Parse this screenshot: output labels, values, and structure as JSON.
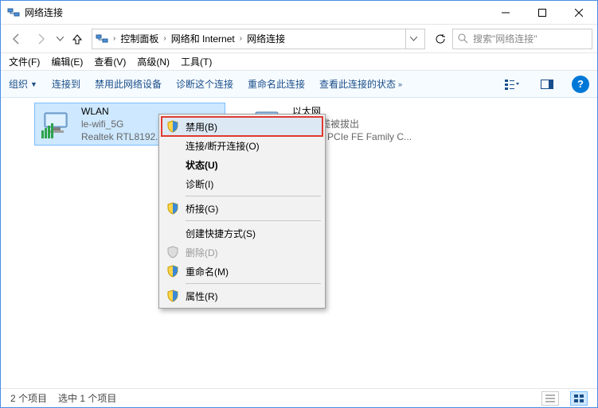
{
  "window": {
    "title": "网络连接",
    "minimize": "—",
    "maximize": "☐",
    "close": "✕"
  },
  "breadcrumb": {
    "items": [
      "控制面板",
      "网络和 Internet",
      "网络连接"
    ]
  },
  "search": {
    "placeholder": "搜索\"网络连接\""
  },
  "menubar": {
    "file": "文件(F)",
    "edit": "编辑(E)",
    "view": "查看(V)",
    "advanced": "高级(N)",
    "tools": "工具(T)"
  },
  "cmdbar": {
    "organize": "组织",
    "connect": "连接到",
    "disable": "禁用此网络设备",
    "diagnose": "诊断这个连接",
    "rename": "重命名此连接",
    "status": "查看此连接的状态"
  },
  "connections": {
    "wlan": {
      "name": "WLAN",
      "line2": "le-wifi_5G",
      "line3": "Realtek RTL8192..."
    },
    "eth": {
      "name": "以太网",
      "line2": "网络电缆被拔出",
      "line3": "Realtek PCIe FE Family C..."
    }
  },
  "context_menu": {
    "disable": "禁用(B)",
    "connect": "连接/断开连接(O)",
    "status": "状态(U)",
    "diagnose": "诊断(I)",
    "bridge": "桥接(G)",
    "shortcut": "创建快捷方式(S)",
    "delete": "删除(D)",
    "rename": "重命名(M)",
    "properties": "属性(R)"
  },
  "statusbar": {
    "count": "2 个项目",
    "selected": "选中 1 个项目"
  }
}
